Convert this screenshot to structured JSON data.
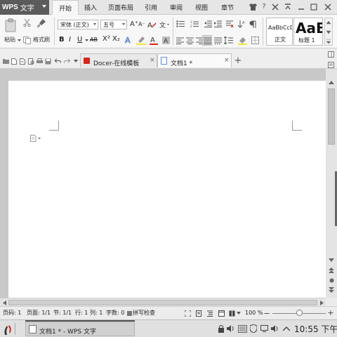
{
  "app": {
    "brand": "WPS",
    "name": "文字"
  },
  "menu": {
    "tabs": [
      "开始",
      "插入",
      "页面布局",
      "引用",
      "审阅",
      "视图",
      "章节"
    ],
    "active": "开始"
  },
  "ribbon": {
    "paste_label": "粘贴",
    "format_painter_label": "格式刷",
    "font_name": "宋体 (正文)",
    "font_size": "五号",
    "style_normal_preview": "AaBbCcD",
    "style_normal_label": "正文",
    "style_heading_preview": "AaB",
    "style_heading_label": "标题 1",
    "bold": "B",
    "italic": "I",
    "underline": "U",
    "strike": "AB",
    "superscript": "X²",
    "subscript": "X₂",
    "grow": "A⁺",
    "shrink": "A⁻",
    "clear": "A",
    "fontcolor": "A"
  },
  "tabs": [
    {
      "label": "Docer-在线模板"
    },
    {
      "label": "文档1 *"
    }
  ],
  "statusbar": {
    "page": "页码: 1",
    "pages": "页面: 1/1",
    "section": "节: 1/1",
    "line": "行: 1",
    "col": "列: 1",
    "words": "字数: 0",
    "spell": "拼写检查",
    "zoom": "100 %"
  },
  "taskbar": {
    "task": "文档1 * - WPS 文字",
    "time": "10:55 下午"
  },
  "colors": {
    "accent": "#d6261d",
    "brand_bg": "#5b5b5b",
    "highlight": "#f2e533"
  }
}
